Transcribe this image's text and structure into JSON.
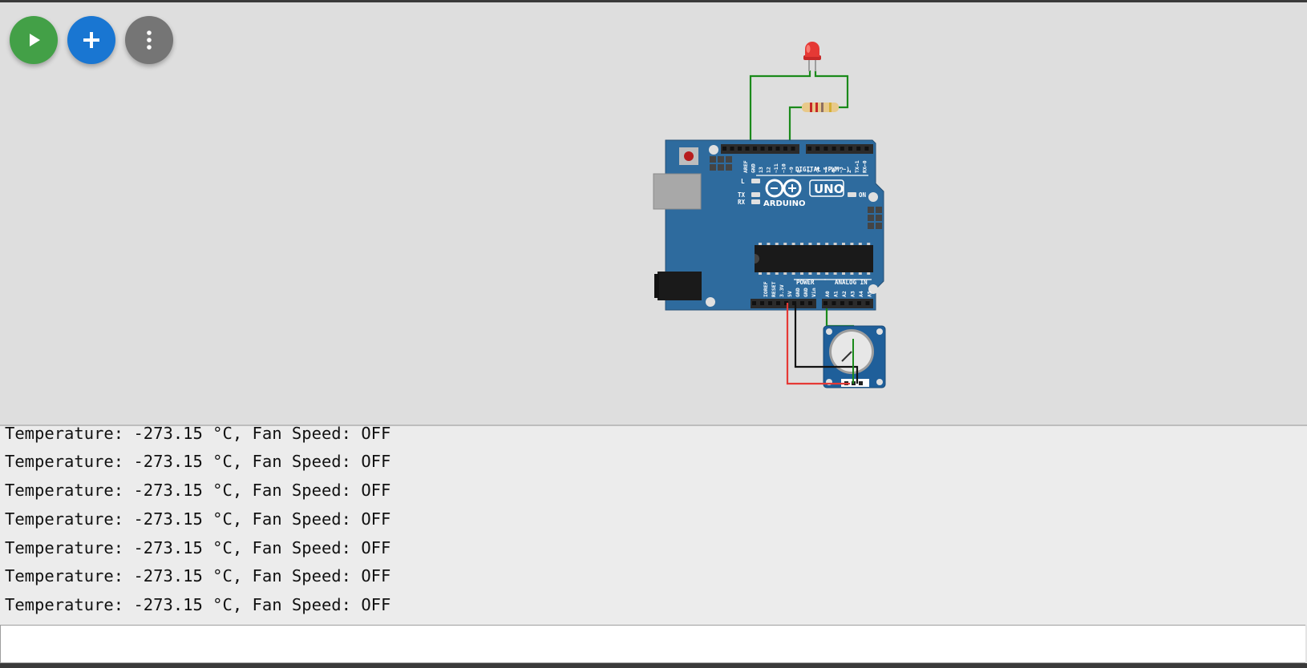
{
  "toolbar": {
    "run_icon": "play-icon",
    "add_icon": "plus-icon",
    "more_icon": "more-vertical-icon",
    "colors": {
      "run": "#43a047",
      "add": "#1976d2",
      "more": "#757575"
    }
  },
  "board": {
    "brand": "ARDUINO",
    "model": "UNO",
    "digital_header_label": "DIGITAL (PWM ~)",
    "power_label": "POWER",
    "analog_label": "ANALOG IN",
    "led_labels": [
      "L",
      "TX",
      "RX",
      "ON"
    ],
    "digital_pins": [
      "AREF",
      "GND",
      "13",
      "12",
      "~11",
      "~10",
      "~9",
      "8",
      "7",
      "~6",
      "~5",
      "4",
      "~3",
      "2",
      "TX→1",
      "RX←0"
    ],
    "power_pins": [
      "IOREF",
      "RESET",
      "3.3V",
      "5V",
      "GND",
      "GND",
      "Vin"
    ],
    "analog_pins": [
      "A0",
      "A1",
      "A2",
      "A3",
      "A4",
      "A5"
    ],
    "colors": {
      "pcb": "#2e6b9e",
      "accent": "#ffffff"
    }
  },
  "components": {
    "led_color": "#e53935",
    "wire_colors": {
      "signal": "#1b8a1b",
      "power": "#e53935",
      "ground": "#111111"
    }
  },
  "console": {
    "lines": [
      "Temperature: -273.15 °C, Fan Speed: OFF",
      "Temperature: -273.15 °C, Fan Speed: OFF",
      "Temperature: -273.15 °C, Fan Speed: OFF",
      "Temperature: -273.15 °C, Fan Speed: OFF",
      "Temperature: -273.15 °C, Fan Speed: OFF",
      "Temperature: -273.15 °C, Fan Speed: OFF",
      "Temperature: -273.15 °C, Fan Speed: OFF"
    ]
  },
  "serial_input": {
    "value": "",
    "placeholder": ""
  }
}
